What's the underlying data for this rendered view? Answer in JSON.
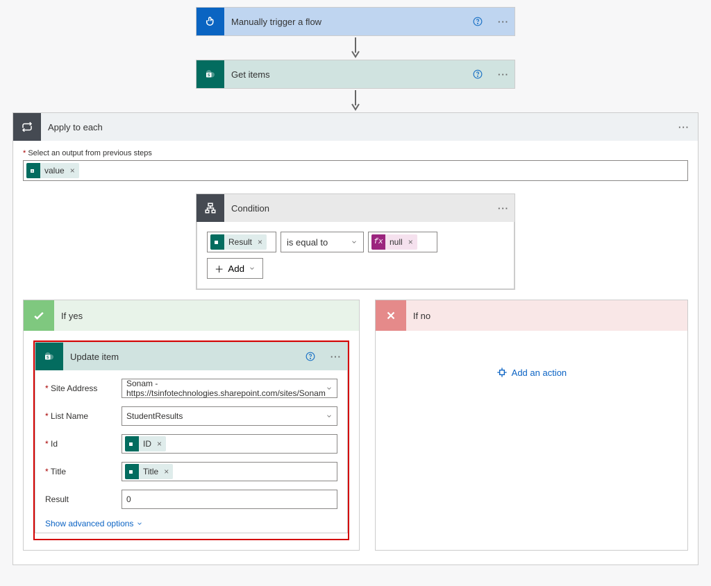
{
  "trigger": {
    "title": "Manually trigger a flow"
  },
  "getitems": {
    "title": "Get items"
  },
  "applyToEach": {
    "title": "Apply to each",
    "outputLabel": "Select an output from previous steps",
    "token": "value"
  },
  "condition": {
    "title": "Condition",
    "leftToken": "Result",
    "operator": "is equal to",
    "rightToken": "null",
    "addLabel": "Add"
  },
  "ifyes": {
    "title": "If yes"
  },
  "ifno": {
    "title": "If no",
    "addAction": "Add an action"
  },
  "updateItem": {
    "title": "Update item",
    "siteAddressLabel": "Site Address",
    "siteAddressValue": "Sonam - https://tsinfotechnologies.sharepoint.com/sites/Sonam",
    "listNameLabel": "List Name",
    "listNameValue": "StudentResults",
    "idLabel": "Id",
    "idToken": "ID",
    "titleLabel": "Title",
    "titleToken": "Title",
    "resultLabel": "Result",
    "resultValue": "0",
    "showAdvanced": "Show advanced options"
  }
}
